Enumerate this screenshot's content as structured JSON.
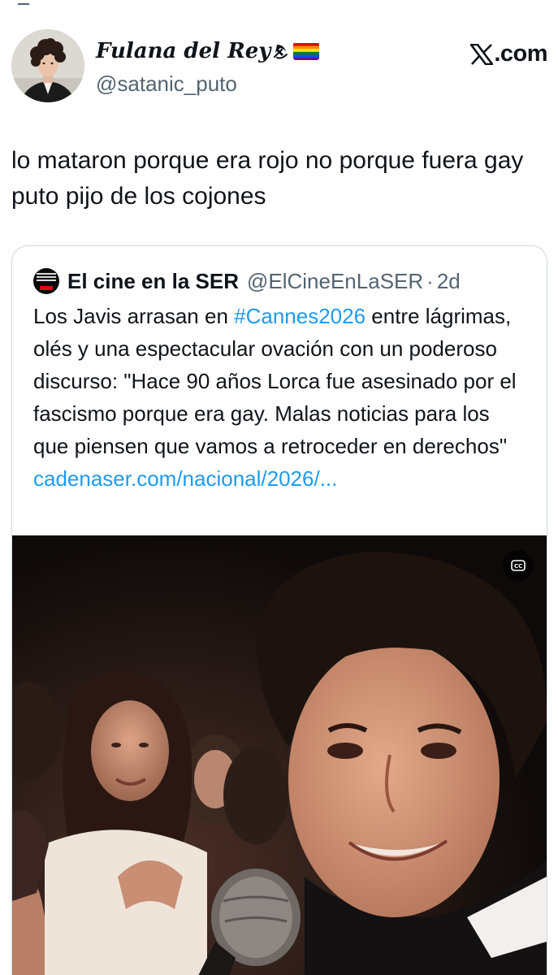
{
  "author": {
    "display_name": "Fulana del Rey",
    "handle": "@satanic_puto",
    "avatar_icon": "profile-photo-avatar",
    "name_emojis": [
      "hammer-and-sickle-icon",
      "rainbow-flag-icon"
    ]
  },
  "source_brand": {
    "label": ".com",
    "logo_icon": "x-logo-icon"
  },
  "tweet": {
    "text": "lo mataron porque era rojo no porque fuera gay puto pijo de los cojones"
  },
  "quoted_tweet": {
    "avatar_icon": "el-cine-en-la-ser-avatar",
    "display_name": "El cine en la SER",
    "handle": "@ElCineEnLaSER",
    "separator": "·",
    "time": "2d",
    "text_before_hashtag": "Los Javis arrasan en ",
    "hashtag": "#Cannes2026",
    "text_after_hashtag": " entre lágrimas, olés y una espectacular ovación con un poderoso discurso: \"Hace 90 años Lorca fue asesinado por el fascismo porque era gay. Malas noticias para los que piensen que vamos a retroceder en derechos\"",
    "link": "cadenaser.com/nacional/2026/...",
    "media": {
      "type": "video-still",
      "caption_badge_icon": "closed-captions-icon"
    }
  },
  "colors": {
    "text": "#0f1419",
    "secondary": "#536471",
    "link": "#1d9bf0",
    "border": "#cfd9de",
    "ser_red": "#e30613"
  }
}
